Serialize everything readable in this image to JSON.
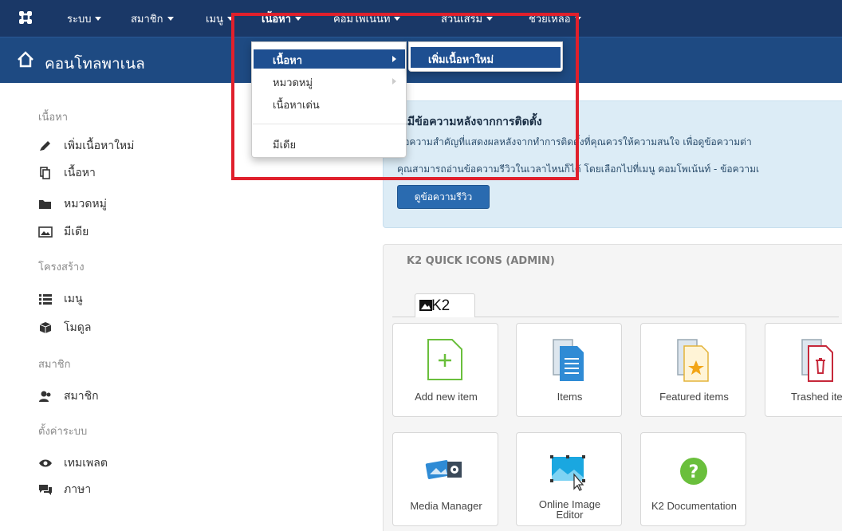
{
  "navbar": {
    "items": [
      {
        "label": "ระบบ"
      },
      {
        "label": "สมาชิก"
      },
      {
        "label": "เมนู"
      },
      {
        "label": "เนื้อหา"
      },
      {
        "label": "คอมโพเน้นท์"
      },
      {
        "label": "ส่วนเสริม"
      },
      {
        "label": "ช่วยเหลือ"
      }
    ]
  },
  "header": {
    "title": "คอนโทลพาเนล"
  },
  "sidebar": {
    "sections": [
      {
        "heading": "เนื้อหา",
        "items": [
          {
            "label": "เพิ่มเนื้อหาใหม่",
            "icon": "pencil-icon"
          },
          {
            "label": "เนื้อหา",
            "icon": "copy-icon"
          },
          {
            "label": "หมวดหมู่",
            "icon": "folder-icon"
          },
          {
            "label": "มีเดีย",
            "icon": "image-icon"
          }
        ]
      },
      {
        "heading": "โครงสร้าง",
        "items": [
          {
            "label": "เมนู",
            "icon": "list-icon"
          },
          {
            "label": "โมดูล",
            "icon": "cube-icon"
          }
        ]
      },
      {
        "heading": "สมาชิก",
        "items": [
          {
            "label": "สมาชิก",
            "icon": "user-icon"
          }
        ]
      },
      {
        "heading": "ตั้งค่าระบบ",
        "items": [
          {
            "label": "เทมเพลต",
            "icon": "eye-icon"
          },
          {
            "label": "ภาษา",
            "icon": "comments-icon"
          }
        ]
      }
    ]
  },
  "message": {
    "title": "ณมีข้อความหลังจากการติดตั้ง",
    "line1": "ข้อความสำคัญที่แสดงผลหลังจากทำการติดตั้งที่คุณควรให้ความสนใจ เพื่อดูข้อความต่า",
    "line2": "คุณสามารถอ่านข้อความรีวิวในเวลาไหนก็ได้ โดยเลือกไปที่เมนู คอมโพเน้นท์ - ข้อความเ",
    "button": "ดูข้อความรีวิว"
  },
  "k2": {
    "title": "K2 QUICK ICONS (ADMIN)",
    "tab": "K2",
    "icons": [
      {
        "label": "Add new item",
        "icon": "add-item-icon"
      },
      {
        "label": "Items",
        "icon": "items-icon"
      },
      {
        "label": "Featured items",
        "icon": "featured-items-icon"
      },
      {
        "label": "Trashed iter",
        "icon": "trashed-items-icon"
      },
      {
        "label": "Media Manager",
        "icon": "media-manager-icon"
      },
      {
        "label1": "Online Image",
        "label2": "Editor",
        "icon": "image-editor-icon"
      },
      {
        "label": "K2 Documentation",
        "icon": "help-icon"
      }
    ]
  },
  "dropdown": {
    "items": [
      {
        "label": "เนื้อหา",
        "active": true,
        "has_submenu": true
      },
      {
        "label": "หมวดหมู่",
        "active": false,
        "has_submenu": true
      },
      {
        "label": "เนื้อหาเด่น",
        "active": false,
        "has_submenu": false
      },
      {
        "label": "มีเดีย",
        "active": false,
        "has_submenu": false
      }
    ],
    "submenu": [
      {
        "label": "เพิ่มเนื้อหาใหม่",
        "active": true
      }
    ]
  },
  "colors": {
    "topbar": "#1a3867",
    "header": "#1e4a82",
    "highlight": "#e0202c",
    "menu_active": "#1e4f91"
  }
}
